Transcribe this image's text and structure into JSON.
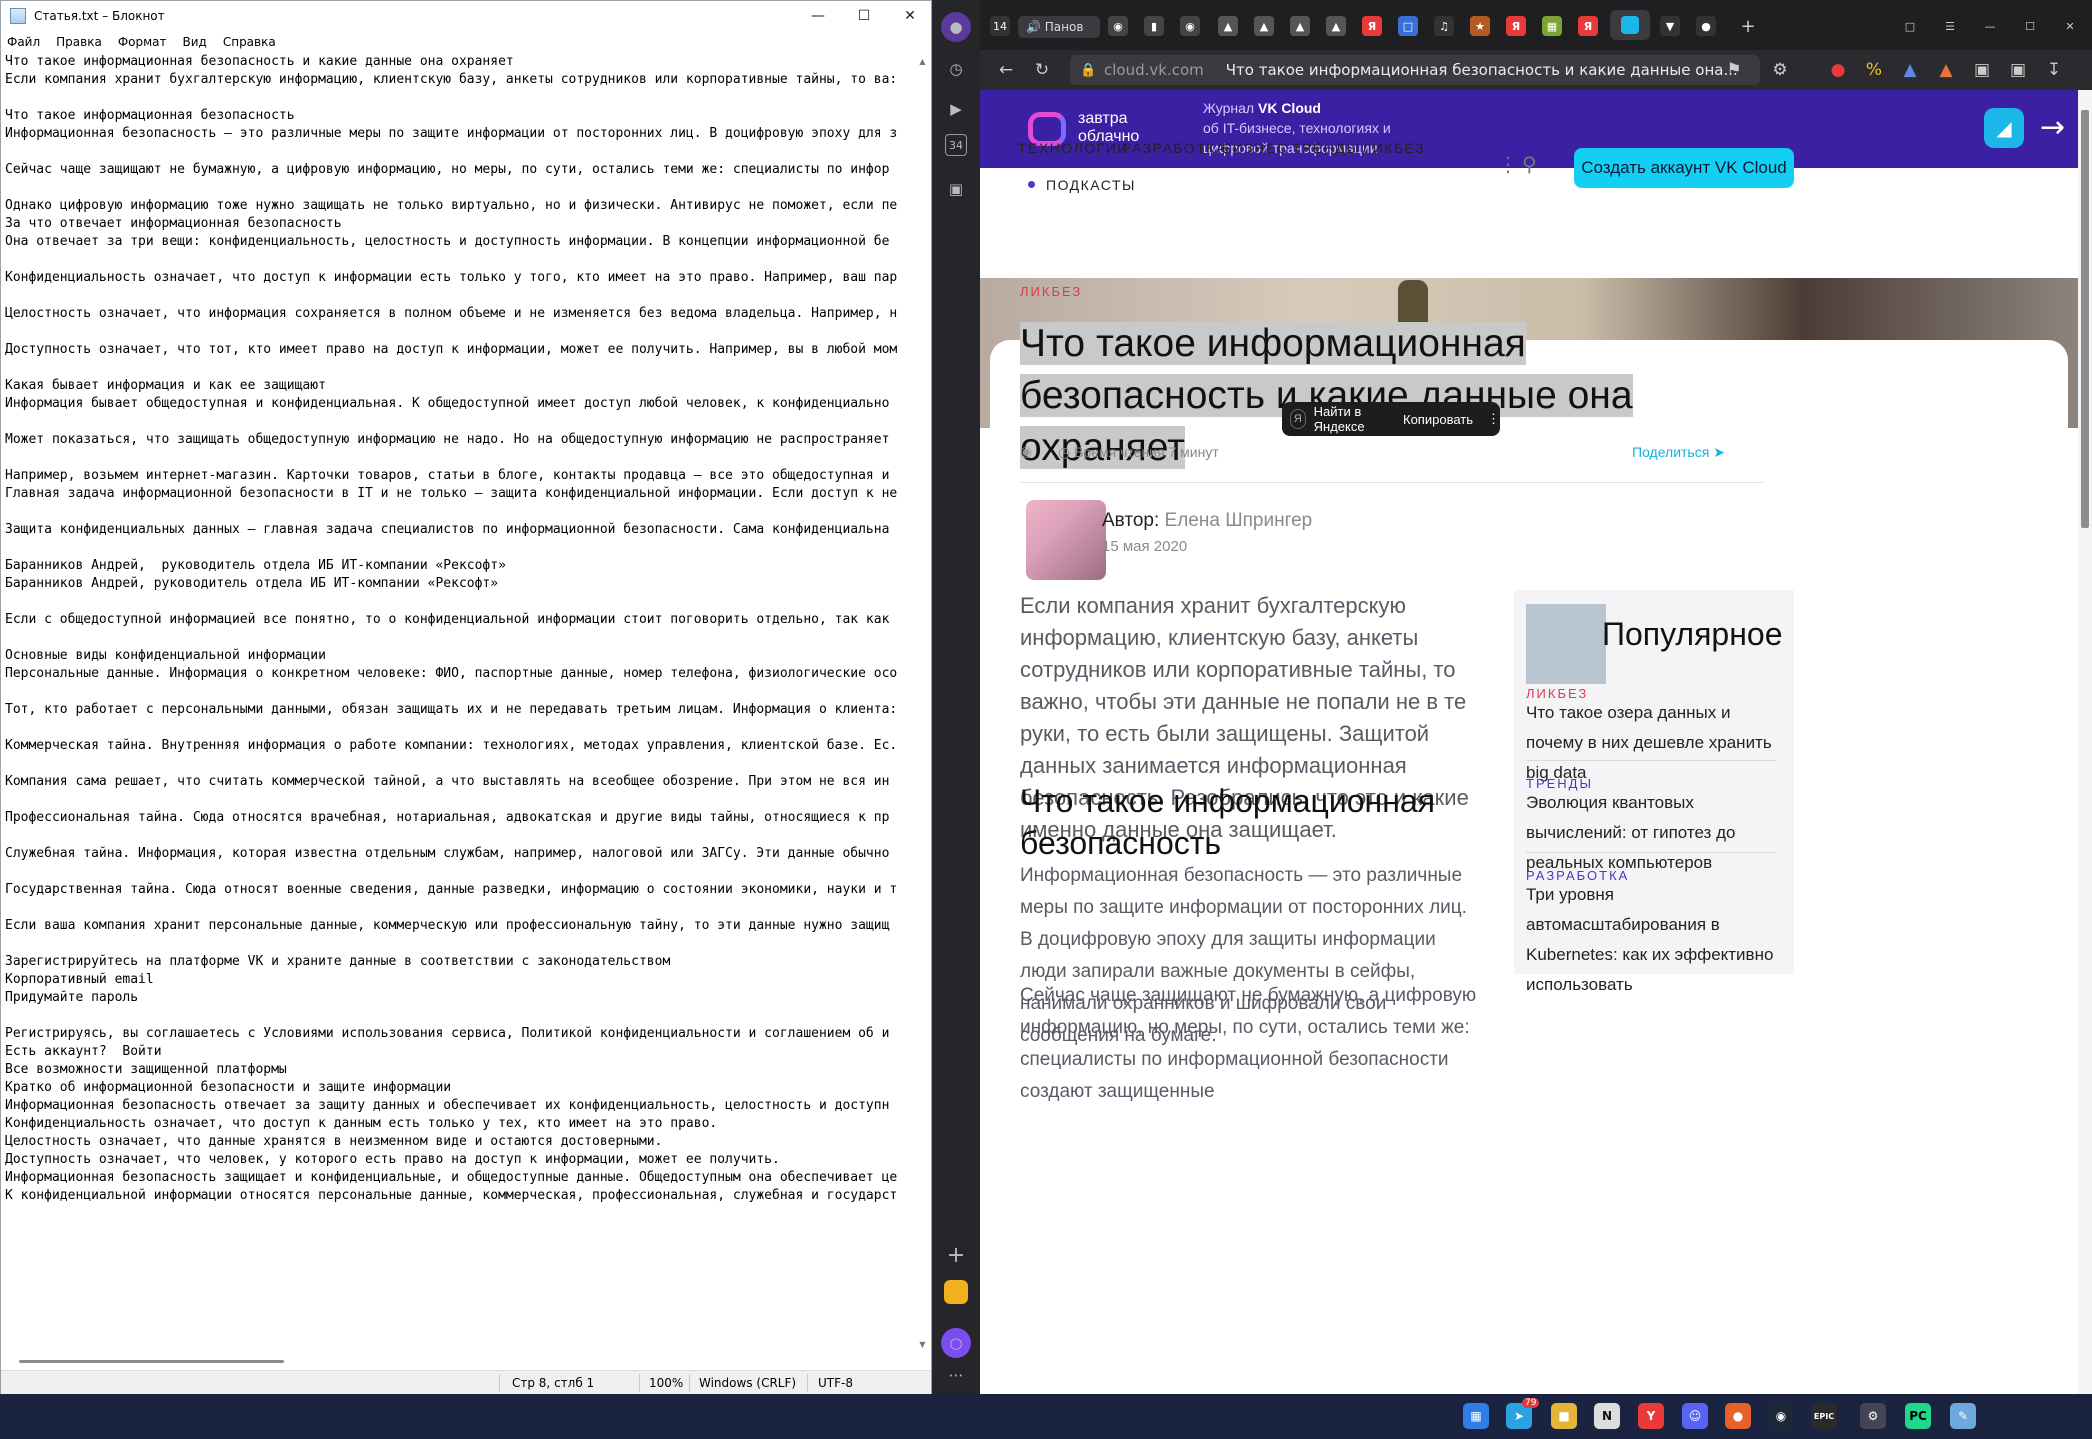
{
  "notepad": {
    "title": "Статья.txt – Блокнот",
    "menu": [
      "Файл",
      "Правка",
      "Формат",
      "Вид",
      "Справка"
    ],
    "lines": [
      "Что такое информационная безопасность и какие данные она охраняет",
      "Если компания хранит бухгалтерскую информацию, клиентскую базу, анкеты сотрудников или корпоративные тайны, то ва:",
      "",
      "Что такое информационная безопасность",
      "Информационная безопасность — это различные меры по защите информации от посторонних лиц. В доцифровую эпоху для з",
      "",
      "Сейчас чаще защищают не бумажную, а цифровую информацию, но меры, по сути, остались теми же: специалисты по инфор",
      "",
      "Однако цифровую информацию тоже нужно защищать не только виртуально, но и физически. Антивирус не поможет, если пе",
      "За что отвечает информационная безопасность",
      "Она отвечает за три вещи: конфиденциальность, целостность и доступность информации. В концепции информационной бе",
      "",
      "Конфиденциальность означает, что доступ к информации есть только у того, кто имеет на это право. Например, ваш пар",
      "",
      "Целостность означает, что информация сохраняется в полном объеме и не изменяется без ведома владельца. Например, н",
      "",
      "Доступность означает, что тот, кто имеет право на доступ к информации, может ее получить. Например, вы в любой мом",
      "",
      "Какая бывает информация и как ее защищают",
      "Информация бывает общедоступная и конфиденциальная. К общедоступной имеет доступ любой человек, к конфиденциально",
      "",
      "Может показаться, что защищать общедоступную информацию не надо. Но на общедоступную информацию не распространяет",
      "",
      "Например, возьмем интернет-магазин. Карточки товаров, статьи в блоге, контакты продавца — все это общедоступная и",
      "Главная задача информационной безопасности в IT и не только — защита конфиденциальной информации. Если доступ к не",
      "",
      "Защита конфиденциальных данных — главная задача специалистов по информационной безопасности. Сама конфиденциальна",
      "",
      "Баранников Андрей,  руководитель отдела ИБ ИТ-компании «Рексофт»",
      "Баранников Андрей, руководитель отдела ИБ ИТ-компании «Рексофт»",
      "",
      "Если с общедоступной информацией все понятно, то о конфиденциальной информации стоит поговорить отдельно, так как",
      "",
      "Основные виды конфиденциальной информации",
      "Персональные данные. Информация о конкретном человеке: ФИО, паспортные данные, номер телефона, физиологические осо",
      "",
      "Тот, кто работает с персональными данными, обязан защищать их и не передавать третьим лицам. Информация о клиента:",
      "",
      "Коммерческая тайна. Внутренняя информация о работе компании: технологиях, методах управления, клиентской базе. Ес.",
      "",
      "Компания сама решает, что считать коммерческой тайной, а что выставлять на всеобщее обозрение. При этом не вся ин",
      "",
      "Профессиональная тайна. Сюда относятся врачебная, нотариальная, адвокатская и другие виды тайны, относящиеся к пр",
      "",
      "Служебная тайна. Информация, которая известна отдельным службам, например, налоговой или ЗАГСу. Эти данные обычно",
      "",
      "Государственная тайна. Сюда относят военные сведения, данные разведки, информацию о состоянии экономики, науки и т",
      "",
      "Если ваша компания хранит персональные данные, коммерческую или профессиональную тайну, то эти данные нужно защищ",
      "",
      "Зарегистрируйтесь на платформе VK и храните данные в соответствии с законодательством",
      "Корпоративный email",
      "Придумайте пароль",
      "",
      "Регистрируясь, вы соглашаетесь с Условиями использования сервиса, Политикой конфиденциальности и соглашением об и",
      "Есть аккаунт?  Войти",
      "Все возможности защищенной платформы",
      "Кратко об информационной безопасности и защите информации",
      "Информационная безопасность отвечает за защиту данных и обеспечивает их конфиденциальность, целостность и доступн",
      "Конфиденциальность означает, что доступ к данным есть только у тех, кто имеет на это право.",
      "Целостность означает, что данные хранятся в неизменном виде и остаются достоверными.",
      "Доступность означает, что человек, у которого есть право на доступ к информации, может ее получить.",
      "Информационная безопасность защищает и конфиденциальные, и общедоступные данные. Общедоступным она обеспечивает це",
      "К конфиденциальной информации относятся персональные данные, коммерческая, профессиональная, служебная и государст"
    ],
    "status": {
      "position": "Стр 8, стлб 1",
      "zoom": "100%",
      "line_endings": "Windows (CRLF)",
      "encoding": "UTF-8"
    }
  },
  "browser": {
    "sidebar_badge": "34",
    "tab_count": "14",
    "profile": "Панов",
    "address": {
      "domain": "cloud.vk.com",
      "title": "Что такое информационная безопасность и какие данные она..."
    },
    "site": {
      "logo_text": "завтра облачно",
      "journal_prefix": "Журнал",
      "journal_brand": "VK Cloud",
      "journal_desc": "об IT-бизнесе, технологиях и цифровой трансформации",
      "nav": [
        "ТЕХНОЛОГИИ",
        "РАЗРАБОТКА",
        "БИЗНЕС",
        "ТРЕНДЫ",
        "ЛИКБЕЗ"
      ],
      "nav_podcasts": "ПОДКАСТЫ",
      "cta": "Создать аккаунт VK Cloud"
    },
    "article": {
      "category": "ЛИКБЕЗ",
      "title": "Что такое информационная безопасность и какие данные она охраняет",
      "popup": {
        "search": "Найти в Яндексе",
        "copy": "Копировать"
      },
      "read_time": "Время чтения 7 минут",
      "share": "Поделиться",
      "author_label": "Автор:",
      "author_name": "Елена Шпрингер",
      "date": "15 мая 2020",
      "lead": "Если компания хранит бухгалтерскую информацию, клиентскую базу, анкеты сотрудников или корпоративные тайны, то важно, чтобы эти данные не попали не в те руки, то есть были защищены. Защитой данных занимается информационная безопасность. Разобрались, что это и какие именно данные она защищает.",
      "h2": "Что такое информационная безопасность",
      "p1": "Информационная безопасность — это различные меры по защите информации от посторонних лиц. В доцифровую эпоху для защиты информации люди запирали важные документы в сейфы, нанимали охранников и шифровали свои сообщения на бумаге.",
      "p2": "Сейчас чаще защищают не бумажную, а цифровую информацию, но меры, по сути, остались теми же: специалисты по информационной безопасности создают защищенные"
    },
    "popular": {
      "title": "Популярное",
      "items": [
        {
          "category": "ЛИКБЕЗ",
          "color": "#e0384e",
          "title": "Что такое озера данных и почему в них дешевле хранить big data"
        },
        {
          "category": "ТРЕНДЫ",
          "color": "#4d37c8",
          "title": "Эволюция квантовых вычислений: от гипотез до реальных компьютеров"
        },
        {
          "category": "РАЗРАБОТКА",
          "color": "#4d37c8",
          "title": "Три уровня автомасштабирования в Kubernetes: как их эффективно использовать"
        }
      ]
    }
  },
  "taskbar": {
    "telegram_badge": "79"
  }
}
